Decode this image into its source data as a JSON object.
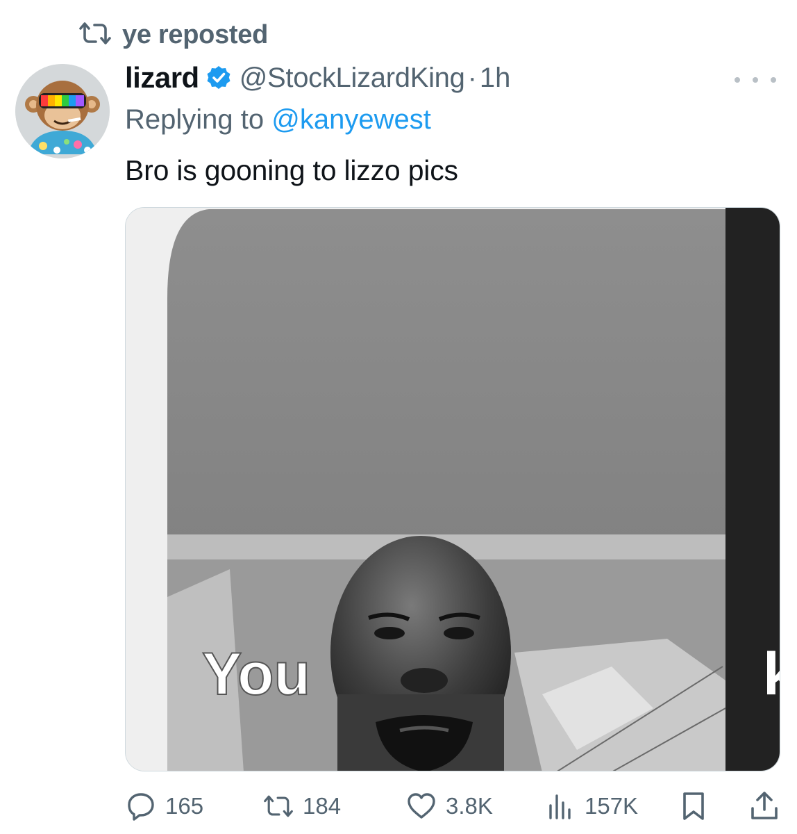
{
  "repost": {
    "label": "ye reposted"
  },
  "author": {
    "display_name": "lizard",
    "handle": "@StockLizardKing",
    "separator": "·",
    "time": "1h"
  },
  "reply": {
    "prefix": "Replying to ",
    "mention": "@kanyewest"
  },
  "text": "Bro is gooning to lizzo pics",
  "media": {
    "caption_left": "You",
    "caption_right": "k"
  },
  "actions": {
    "replies": "165",
    "reposts": "184",
    "likes": "3.8K",
    "views": "157K"
  },
  "colors": {
    "text": "#0f1419",
    "secondary": "#536471",
    "link": "#1d9bf0",
    "verified": "#1d9bf0"
  },
  "icons": {
    "repost": "repost-icon",
    "verified": "verified-badge-icon",
    "more": "more-icon",
    "reply": "reply-icon",
    "like": "heart-icon",
    "views": "views-icon",
    "bookmark": "bookmark-icon",
    "share": "share-icon"
  }
}
